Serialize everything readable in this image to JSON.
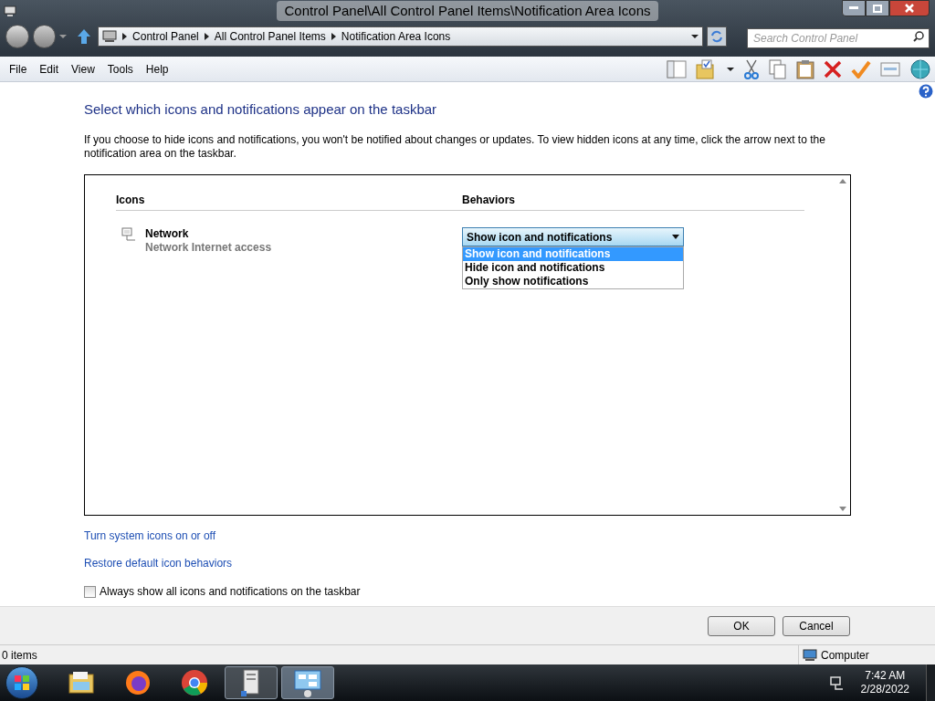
{
  "window": {
    "title": "Control Panel\\All Control Panel Items\\Notification Area Icons"
  },
  "address": {
    "breadcrumbs": [
      "Control Panel",
      "All Control Panel Items",
      "Notification Area Icons"
    ],
    "search_placeholder": "Search Control Panel"
  },
  "menu": [
    "File",
    "Edit",
    "View",
    "Tools",
    "Help"
  ],
  "heading": "Select which icons and notifications appear on the taskbar",
  "description": "If you choose to hide icons and notifications, you won't be notified about changes or updates. To view hidden icons at any time, click the arrow next to the notification area on the taskbar.",
  "table": {
    "columns": [
      "Icons",
      "Behaviors"
    ],
    "rows": [
      {
        "name": "Network",
        "detail": "Network  Internet access",
        "behavior": "Show icon and notifications",
        "expanded": true,
        "options": [
          {
            "label": "Show icon and notifications",
            "selected": true
          },
          {
            "label": "Hide icon and notifications",
            "selected": false
          },
          {
            "label": "Only show notifications",
            "selected": false
          }
        ]
      }
    ]
  },
  "links": [
    "Turn system icons on or off",
    "Restore default icon behaviors"
  ],
  "checkbox": {
    "label": "Always show all icons and notifications on the taskbar",
    "checked": false
  },
  "buttons": [
    "OK",
    "Cancel"
  ],
  "status_bar": {
    "items": "0 items",
    "location": "Computer"
  },
  "taskbar": {
    "apps": [
      {
        "kind": "explorer",
        "open": false,
        "selected": false
      },
      {
        "kind": "firefox",
        "open": false,
        "selected": false
      },
      {
        "kind": "chrome",
        "open": false,
        "selected": false
      },
      {
        "kind": "server",
        "open": true,
        "selected": false
      },
      {
        "kind": "control",
        "open": true,
        "selected": true
      }
    ],
    "time": "7:42 AM",
    "date": "2/28/2022"
  }
}
